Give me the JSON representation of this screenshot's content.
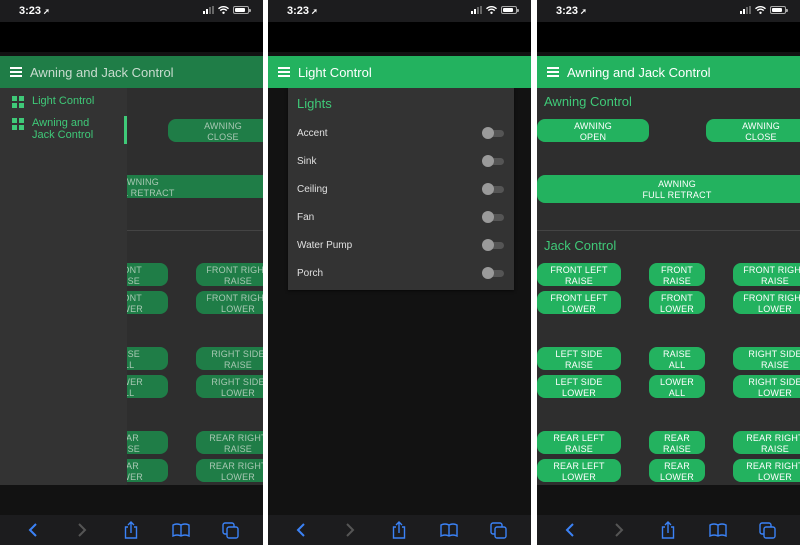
{
  "status": {
    "time": "3:23",
    "location_icon": "location-arrow-icon"
  },
  "colors": {
    "accent": "#23b25f",
    "accent_text": "#3fc978",
    "background": "#2e2e2e",
    "dimmed_accent": "#1f7d47"
  },
  "panel1": {
    "header_title": "Awning and Jack Control",
    "drawer": {
      "items": [
        {
          "label": "Light Control",
          "icon": "dashboard-icon",
          "active": false
        },
        {
          "label": "Awning and Jack Control",
          "icon": "dashboard-icon",
          "active": true
        }
      ]
    }
  },
  "panel2": {
    "header_title": "Light Control",
    "card_title": "Lights",
    "lights": [
      {
        "label": "Accent",
        "on": false
      },
      {
        "label": "Sink",
        "on": false
      },
      {
        "label": "Ceiling",
        "on": false
      },
      {
        "label": "Fan",
        "on": false
      },
      {
        "label": "Water Pump",
        "on": false
      },
      {
        "label": "Porch",
        "on": false
      }
    ]
  },
  "panel3": {
    "header_title": "Awning and Jack Control",
    "awning_title": "Awning Control",
    "jack_title": "Jack Control",
    "awning_buttons": {
      "open": [
        "AWNING",
        "OPEN"
      ],
      "close": [
        "AWNING",
        "CLOSE"
      ],
      "retract": [
        "AWNING",
        "FULL RETRACT"
      ]
    },
    "jack_buttons": {
      "front_left_raise": [
        "FRONT LEFT",
        "RAISE"
      ],
      "front_raise": [
        "FRONT",
        "RAISE"
      ],
      "front_right_raise": [
        "FRONT RIGHT",
        "RAISE"
      ],
      "front_left_lower": [
        "FRONT LEFT",
        "LOWER"
      ],
      "front_lower": [
        "FRONT",
        "LOWER"
      ],
      "front_right_lower": [
        "FRONT RIGHT",
        "LOWER"
      ],
      "left_side_raise": [
        "LEFT SIDE",
        "RAISE"
      ],
      "raise_all": [
        "RAISE",
        "ALL"
      ],
      "right_side_raise": [
        "RIGHT SIDE",
        "RAISE"
      ],
      "left_side_lower": [
        "LEFT SIDE",
        "LOWER"
      ],
      "lower_all": [
        "LOWER",
        "ALL"
      ],
      "right_side_lower": [
        "RIGHT SIDE",
        "LOWER"
      ],
      "rear_left_raise": [
        "REAR LEFT",
        "RAISE"
      ],
      "rear_raise": [
        "REAR",
        "RAISE"
      ],
      "rear_right_raise": [
        "REAR RIGHT",
        "RAISE"
      ],
      "rear_left_lower": [
        "REAR LEFT",
        "LOWER"
      ],
      "rear_lower": [
        "REAR",
        "LOWER"
      ],
      "rear_right_lower": [
        "REAR RIGHT",
        "LOWER"
      ]
    }
  },
  "toolbar": {
    "back_icon": "back-chevron-icon",
    "forward_icon": "forward-chevron-icon",
    "share_icon": "share-icon",
    "bookmarks_icon": "bookmarks-icon",
    "tabs_icon": "tabs-icon"
  }
}
